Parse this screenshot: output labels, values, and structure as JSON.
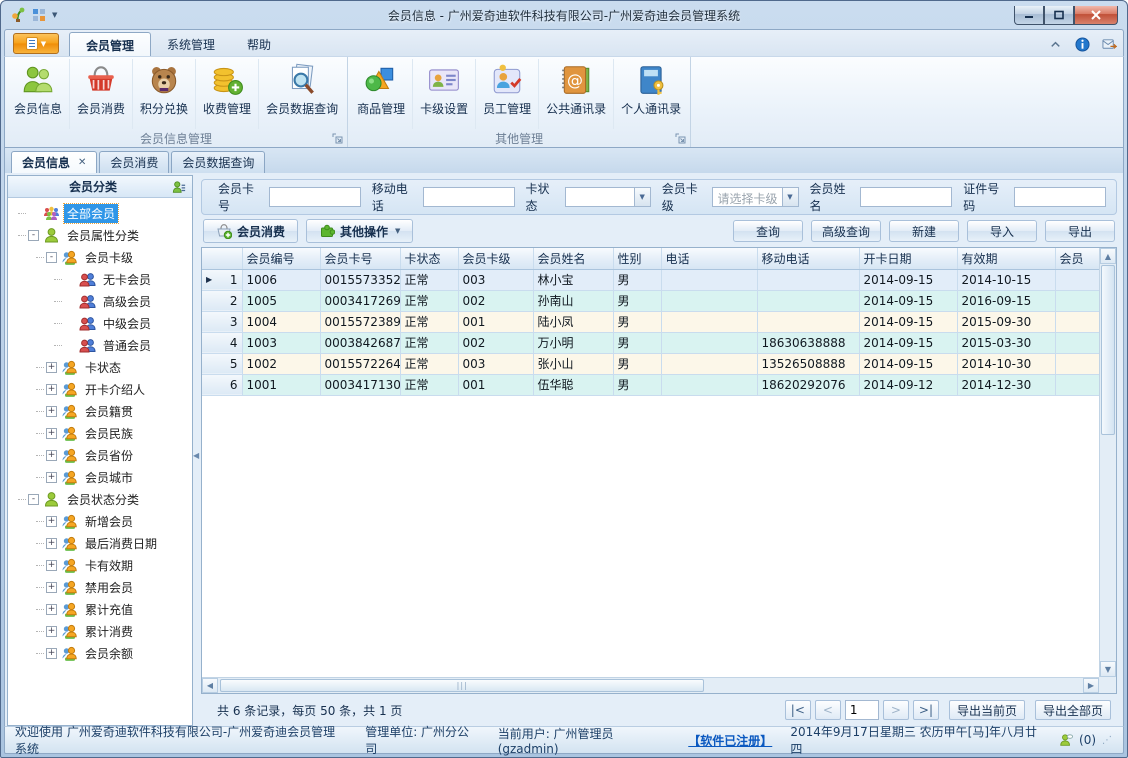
{
  "window": {
    "title": "会员信息 - 广州爱奇迪软件科技有限公司-广州爱奇迪会员管理系统"
  },
  "ribbon": {
    "tabs": [
      "会员管理",
      "系统管理",
      "帮助"
    ],
    "active_tab": "会员管理",
    "groups": [
      {
        "label": "会员信息管理",
        "buttons": [
          {
            "label": "会员信息",
            "icon": "members"
          },
          {
            "label": "会员消费",
            "icon": "basket"
          },
          {
            "label": "积分兑换",
            "icon": "bear"
          },
          {
            "label": "收费管理",
            "icon": "coins"
          },
          {
            "label": "会员数据查询",
            "icon": "docsearch"
          }
        ]
      },
      {
        "label": "其他管理",
        "buttons": [
          {
            "label": "商品管理",
            "icon": "goods"
          },
          {
            "label": "卡级设置",
            "icon": "card"
          },
          {
            "label": "员工管理",
            "icon": "staff"
          },
          {
            "label": "公共通讯录",
            "icon": "pubbook"
          },
          {
            "label": "个人通讯录",
            "icon": "privbook"
          }
        ]
      }
    ]
  },
  "doc_tabs": [
    {
      "label": "会员信息",
      "active": true,
      "closable": true
    },
    {
      "label": "会员消费",
      "active": false,
      "closable": false
    },
    {
      "label": "会员数据查询",
      "active": false,
      "closable": false
    }
  ],
  "sidebar": {
    "header": "会员分类",
    "tree": [
      {
        "label": "全部会员",
        "icon": "group-all",
        "level": 0,
        "expander": "",
        "selected": true
      },
      {
        "label": "会员属性分类",
        "icon": "person-green",
        "level": 0,
        "expander": "-",
        "selected": false
      },
      {
        "label": "会员卡级",
        "icon": "people-orange",
        "level": 1,
        "expander": "-",
        "selected": false
      },
      {
        "label": "无卡会员",
        "icon": "people-redblue",
        "level": 2,
        "expander": "",
        "selected": false
      },
      {
        "label": "高级会员",
        "icon": "people-redblue",
        "level": 2,
        "expander": "",
        "selected": false
      },
      {
        "label": "中级会员",
        "icon": "people-redblue",
        "level": 2,
        "expander": "",
        "selected": false
      },
      {
        "label": "普通会员",
        "icon": "people-redblue",
        "level": 2,
        "expander": "",
        "selected": false
      },
      {
        "label": "卡状态",
        "icon": "people-orange",
        "level": 1,
        "expander": "+",
        "selected": false
      },
      {
        "label": "开卡介绍人",
        "icon": "people-orange",
        "level": 1,
        "expander": "+",
        "selected": false
      },
      {
        "label": "会员籍贯",
        "icon": "people-orange",
        "level": 1,
        "expander": "+",
        "selected": false
      },
      {
        "label": "会员民族",
        "icon": "people-orange",
        "level": 1,
        "expander": "+",
        "selected": false
      },
      {
        "label": "会员省份",
        "icon": "people-orange",
        "level": 1,
        "expander": "+",
        "selected": false
      },
      {
        "label": "会员城市",
        "icon": "people-orange",
        "level": 1,
        "expander": "+",
        "selected": false
      },
      {
        "label": "会员状态分类",
        "icon": "person-green",
        "level": 0,
        "expander": "-",
        "selected": false
      },
      {
        "label": "新增会员",
        "icon": "people-orange",
        "level": 1,
        "expander": "+",
        "selected": false
      },
      {
        "label": "最后消费日期",
        "icon": "people-orange",
        "level": 1,
        "expander": "+",
        "selected": false
      },
      {
        "label": "卡有效期",
        "icon": "people-orange",
        "level": 1,
        "expander": "+",
        "selected": false
      },
      {
        "label": "禁用会员",
        "icon": "people-orange",
        "level": 1,
        "expander": "+",
        "selected": false
      },
      {
        "label": "累计充值",
        "icon": "people-orange",
        "level": 1,
        "expander": "+",
        "selected": false
      },
      {
        "label": "累计消费",
        "icon": "people-orange",
        "level": 1,
        "expander": "+",
        "selected": false
      },
      {
        "label": "会员余额",
        "icon": "people-orange",
        "level": 1,
        "expander": "+",
        "selected": false
      }
    ]
  },
  "search": {
    "fields": [
      {
        "label": "会员卡号",
        "type": "input",
        "value": ""
      },
      {
        "label": "移动电话",
        "type": "input",
        "value": ""
      },
      {
        "label": "卡状态",
        "type": "combo",
        "value": "",
        "placeholder": false
      },
      {
        "label": "会员卡级",
        "type": "combo",
        "value": "请选择卡级",
        "placeholder": true
      },
      {
        "label": "会员姓名",
        "type": "input",
        "value": ""
      },
      {
        "label": "证件号码",
        "type": "input",
        "value": ""
      }
    ]
  },
  "toolbar": {
    "left": [
      {
        "label": "会员消费",
        "icon": "basket-plus",
        "caret": false
      },
      {
        "label": "其他操作",
        "icon": "puzzle",
        "caret": true
      }
    ],
    "right": [
      "查询",
      "高级查询",
      "新建",
      "导入",
      "导出"
    ]
  },
  "grid": {
    "headers": [
      "",
      "会员编号",
      "会员卡号",
      "卡状态",
      "会员卡级",
      "会员姓名",
      "性别",
      "电话",
      "移动电话",
      "开卡日期",
      "有效期",
      "会员"
    ],
    "rows": [
      {
        "num": 1,
        "current": true,
        "cells": [
          "1006",
          "0015573352",
          "正常",
          "003",
          "林小宝",
          "男",
          "",
          "",
          "2014-09-15",
          "2014-10-15",
          ""
        ]
      },
      {
        "num": 2,
        "current": false,
        "cells": [
          "1005",
          "0003417269",
          "正常",
          "002",
          "孙南山",
          "男",
          "",
          "",
          "2014-09-15",
          "2016-09-15",
          ""
        ]
      },
      {
        "num": 3,
        "current": false,
        "cells": [
          "1004",
          "0015572389",
          "正常",
          "001",
          "陆小凤",
          "男",
          "",
          "",
          "2014-09-15",
          "2015-09-30",
          ""
        ]
      },
      {
        "num": 4,
        "current": false,
        "cells": [
          "1003",
          "0003842687",
          "正常",
          "002",
          "万小明",
          "男",
          "",
          "18630638888",
          "2014-09-15",
          "2015-03-30",
          ""
        ]
      },
      {
        "num": 5,
        "current": false,
        "cells": [
          "1002",
          "0015572264",
          "正常",
          "003",
          "张小山",
          "男",
          "",
          "13526508888",
          "2014-09-15",
          "2014-10-30",
          ""
        ]
      },
      {
        "num": 6,
        "current": false,
        "cells": [
          "1001",
          "0003417130",
          "正常",
          "001",
          "伍华聪",
          "男",
          "",
          "18620292076",
          "2014-09-12",
          "2014-12-30",
          ""
        ]
      }
    ]
  },
  "pager": {
    "summary": "共 6 条记录，每页 50 条，共 1 页",
    "first": "|<",
    "prev": "<",
    "page": "1",
    "next": ">",
    "last": ">|",
    "export_current": "导出当前页",
    "export_all": "导出全部页"
  },
  "statusbar": {
    "welcome": "欢迎使用 广州爱奇迪软件科技有限公司-广州爱奇迪会员管理系统",
    "unit": "管理单位: 广州分公司",
    "user": "当前用户: 广州管理员(gzadmin)",
    "registered": "【软件已注册】",
    "date": "2014年9月17日星期三 农历甲午[马]年八月廿四",
    "messages": "(0)"
  }
}
